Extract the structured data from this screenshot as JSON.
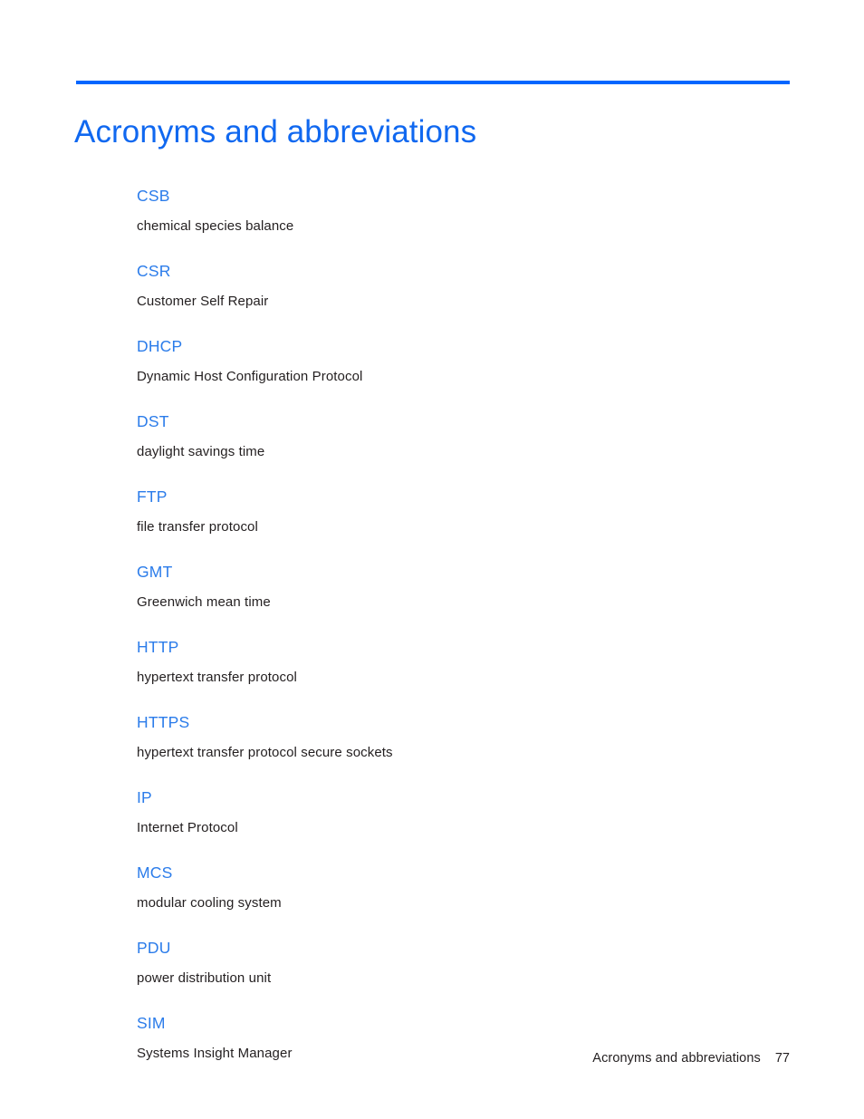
{
  "document": {
    "title": "Acronyms and abbreviations",
    "accent_color": "#0066ff",
    "term_color": "#2b7cea",
    "text_color": "#231f20"
  },
  "entries": [
    {
      "term": "CSB",
      "definition": "chemical species balance"
    },
    {
      "term": "CSR",
      "definition": "Customer Self Repair"
    },
    {
      "term": "DHCP",
      "definition": "Dynamic Host Configuration Protocol"
    },
    {
      "term": "DST",
      "definition": "daylight savings time"
    },
    {
      "term": "FTP",
      "definition": "file transfer protocol"
    },
    {
      "term": "GMT",
      "definition": "Greenwich mean time"
    },
    {
      "term": "HTTP",
      "definition": "hypertext transfer protocol"
    },
    {
      "term": "HTTPS",
      "definition": "hypertext transfer protocol secure sockets"
    },
    {
      "term": "IP",
      "definition": "Internet Protocol"
    },
    {
      "term": "MCS",
      "definition": "modular cooling system"
    },
    {
      "term": "PDU",
      "definition": "power distribution unit"
    },
    {
      "term": "SIM",
      "definition": "Systems Insight Manager"
    }
  ],
  "footer": {
    "label": "Acronyms and abbreviations",
    "page_number": "77"
  }
}
